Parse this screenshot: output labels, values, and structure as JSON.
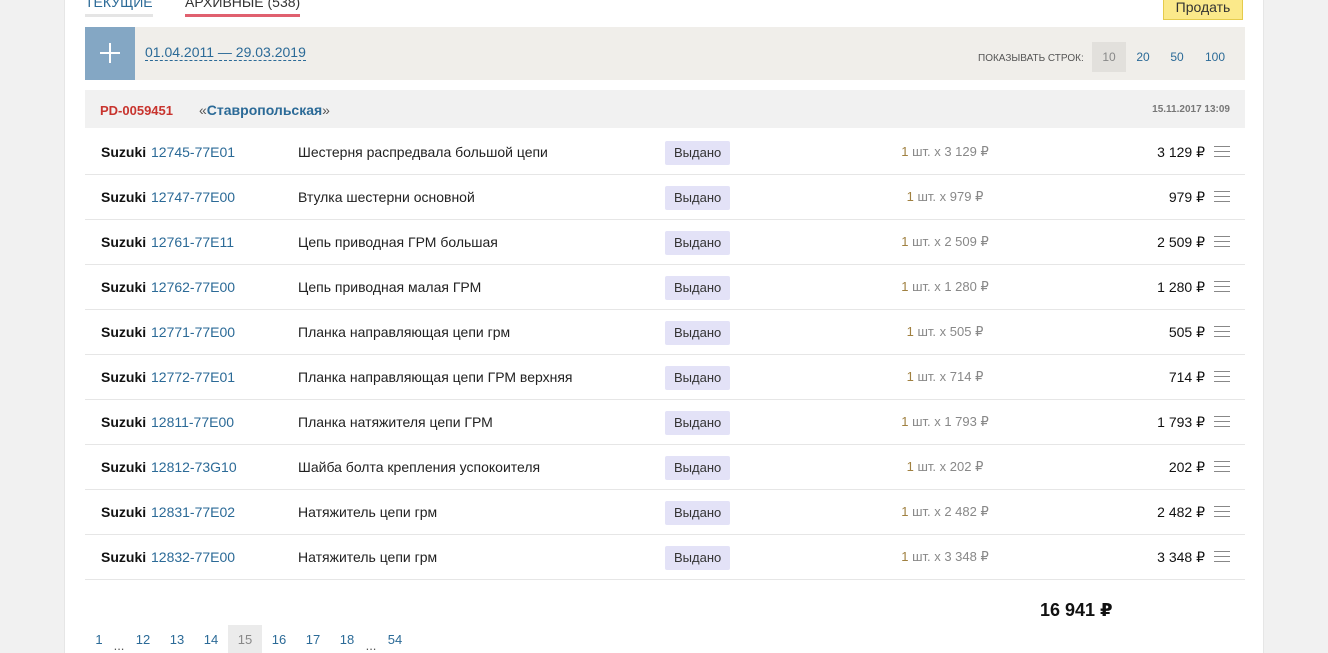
{
  "tabs": {
    "current": "ТЕКУЩИЕ",
    "archive": "АРХИВНЫЕ (538)"
  },
  "sell_button": "Продать",
  "filter": {
    "date_range": "01.04.2011 — 29.03.2019",
    "rows_label": "ПОКАЗЫВАТЬ СТРОК:",
    "rows_options": [
      "10",
      "20",
      "50",
      "100"
    ],
    "rows_selected": "10"
  },
  "order": {
    "id": "PD-0059451",
    "store_prefix": "«",
    "store": "Ставропольская",
    "store_suffix": "»",
    "date": "15.11.2017 13:09"
  },
  "items": [
    {
      "brand": "Suzuki",
      "code": "12745-77E01",
      "name": "Шестерня распредвала большой цепи",
      "status": "Выдано",
      "qty_num": "1",
      "qty_rest": " шт. x 3 129 ₽",
      "price": "3 129 ₽"
    },
    {
      "brand": "Suzuki",
      "code": "12747-77E00",
      "name": "Втулка шестерни основной",
      "status": "Выдано",
      "qty_num": "1",
      "qty_rest": " шт. x 979 ₽",
      "price": "979 ₽"
    },
    {
      "brand": "Suzuki",
      "code": "12761-77E11",
      "name": "Цепь приводная ГРМ большая",
      "status": "Выдано",
      "qty_num": "1",
      "qty_rest": " шт. x 2 509 ₽",
      "price": "2 509 ₽"
    },
    {
      "brand": "Suzuki",
      "code": "12762-77E00",
      "name": "Цепь приводная малая ГРМ",
      "status": "Выдано",
      "qty_num": "1",
      "qty_rest": " шт. x 1 280 ₽",
      "price": "1 280 ₽"
    },
    {
      "brand": "Suzuki",
      "code": "12771-77E00",
      "name": "Планка направляющая цепи грм",
      "status": "Выдано",
      "qty_num": "1",
      "qty_rest": " шт. x 505 ₽",
      "price": "505 ₽"
    },
    {
      "brand": "Suzuki",
      "code": "12772-77E01",
      "name": "Планка направляющая цепи ГРМ верхняя",
      "status": "Выдано",
      "qty_num": "1",
      "qty_rest": " шт. x 714 ₽",
      "price": "714 ₽"
    },
    {
      "brand": "Suzuki",
      "code": "12811-77E00",
      "name": "Планка натяжителя цепи ГРМ",
      "status": "Выдано",
      "qty_num": "1",
      "qty_rest": " шт. x 1 793 ₽",
      "price": "1 793 ₽"
    },
    {
      "brand": "Suzuki",
      "code": "12812-73G10",
      "name": "Шайба болта крепления успокоителя",
      "status": "Выдано",
      "qty_num": "1",
      "qty_rest": " шт. x 202 ₽",
      "price": "202 ₽"
    },
    {
      "brand": "Suzuki",
      "code": "12831-77E02",
      "name": "Натяжитель цепи грм",
      "status": "Выдано",
      "qty_num": "1",
      "qty_rest": " шт. x 2 482 ₽",
      "price": "2 482 ₽"
    },
    {
      "brand": "Suzuki",
      "code": "12832-77E00",
      "name": "Натяжитель цепи грм",
      "status": "Выдано",
      "qty_num": "1",
      "qty_rest": " шт. x 3 348 ₽",
      "price": "3 348 ₽"
    }
  ],
  "total": "16 941 ₽",
  "pagination": {
    "pages": [
      "1",
      "...",
      "12",
      "13",
      "14",
      "15",
      "16",
      "17",
      "18",
      "...",
      "54"
    ],
    "current": "15"
  },
  "icons": {
    "add": "plus-icon",
    "row_menu": "menu-lines-icon"
  },
  "colors": {
    "link": "#2b6a97",
    "order_id": "#c8342e",
    "sell_button": "#fbe98a",
    "status_badge": "#e3e2f7",
    "tab_underline": "#e0606f"
  }
}
